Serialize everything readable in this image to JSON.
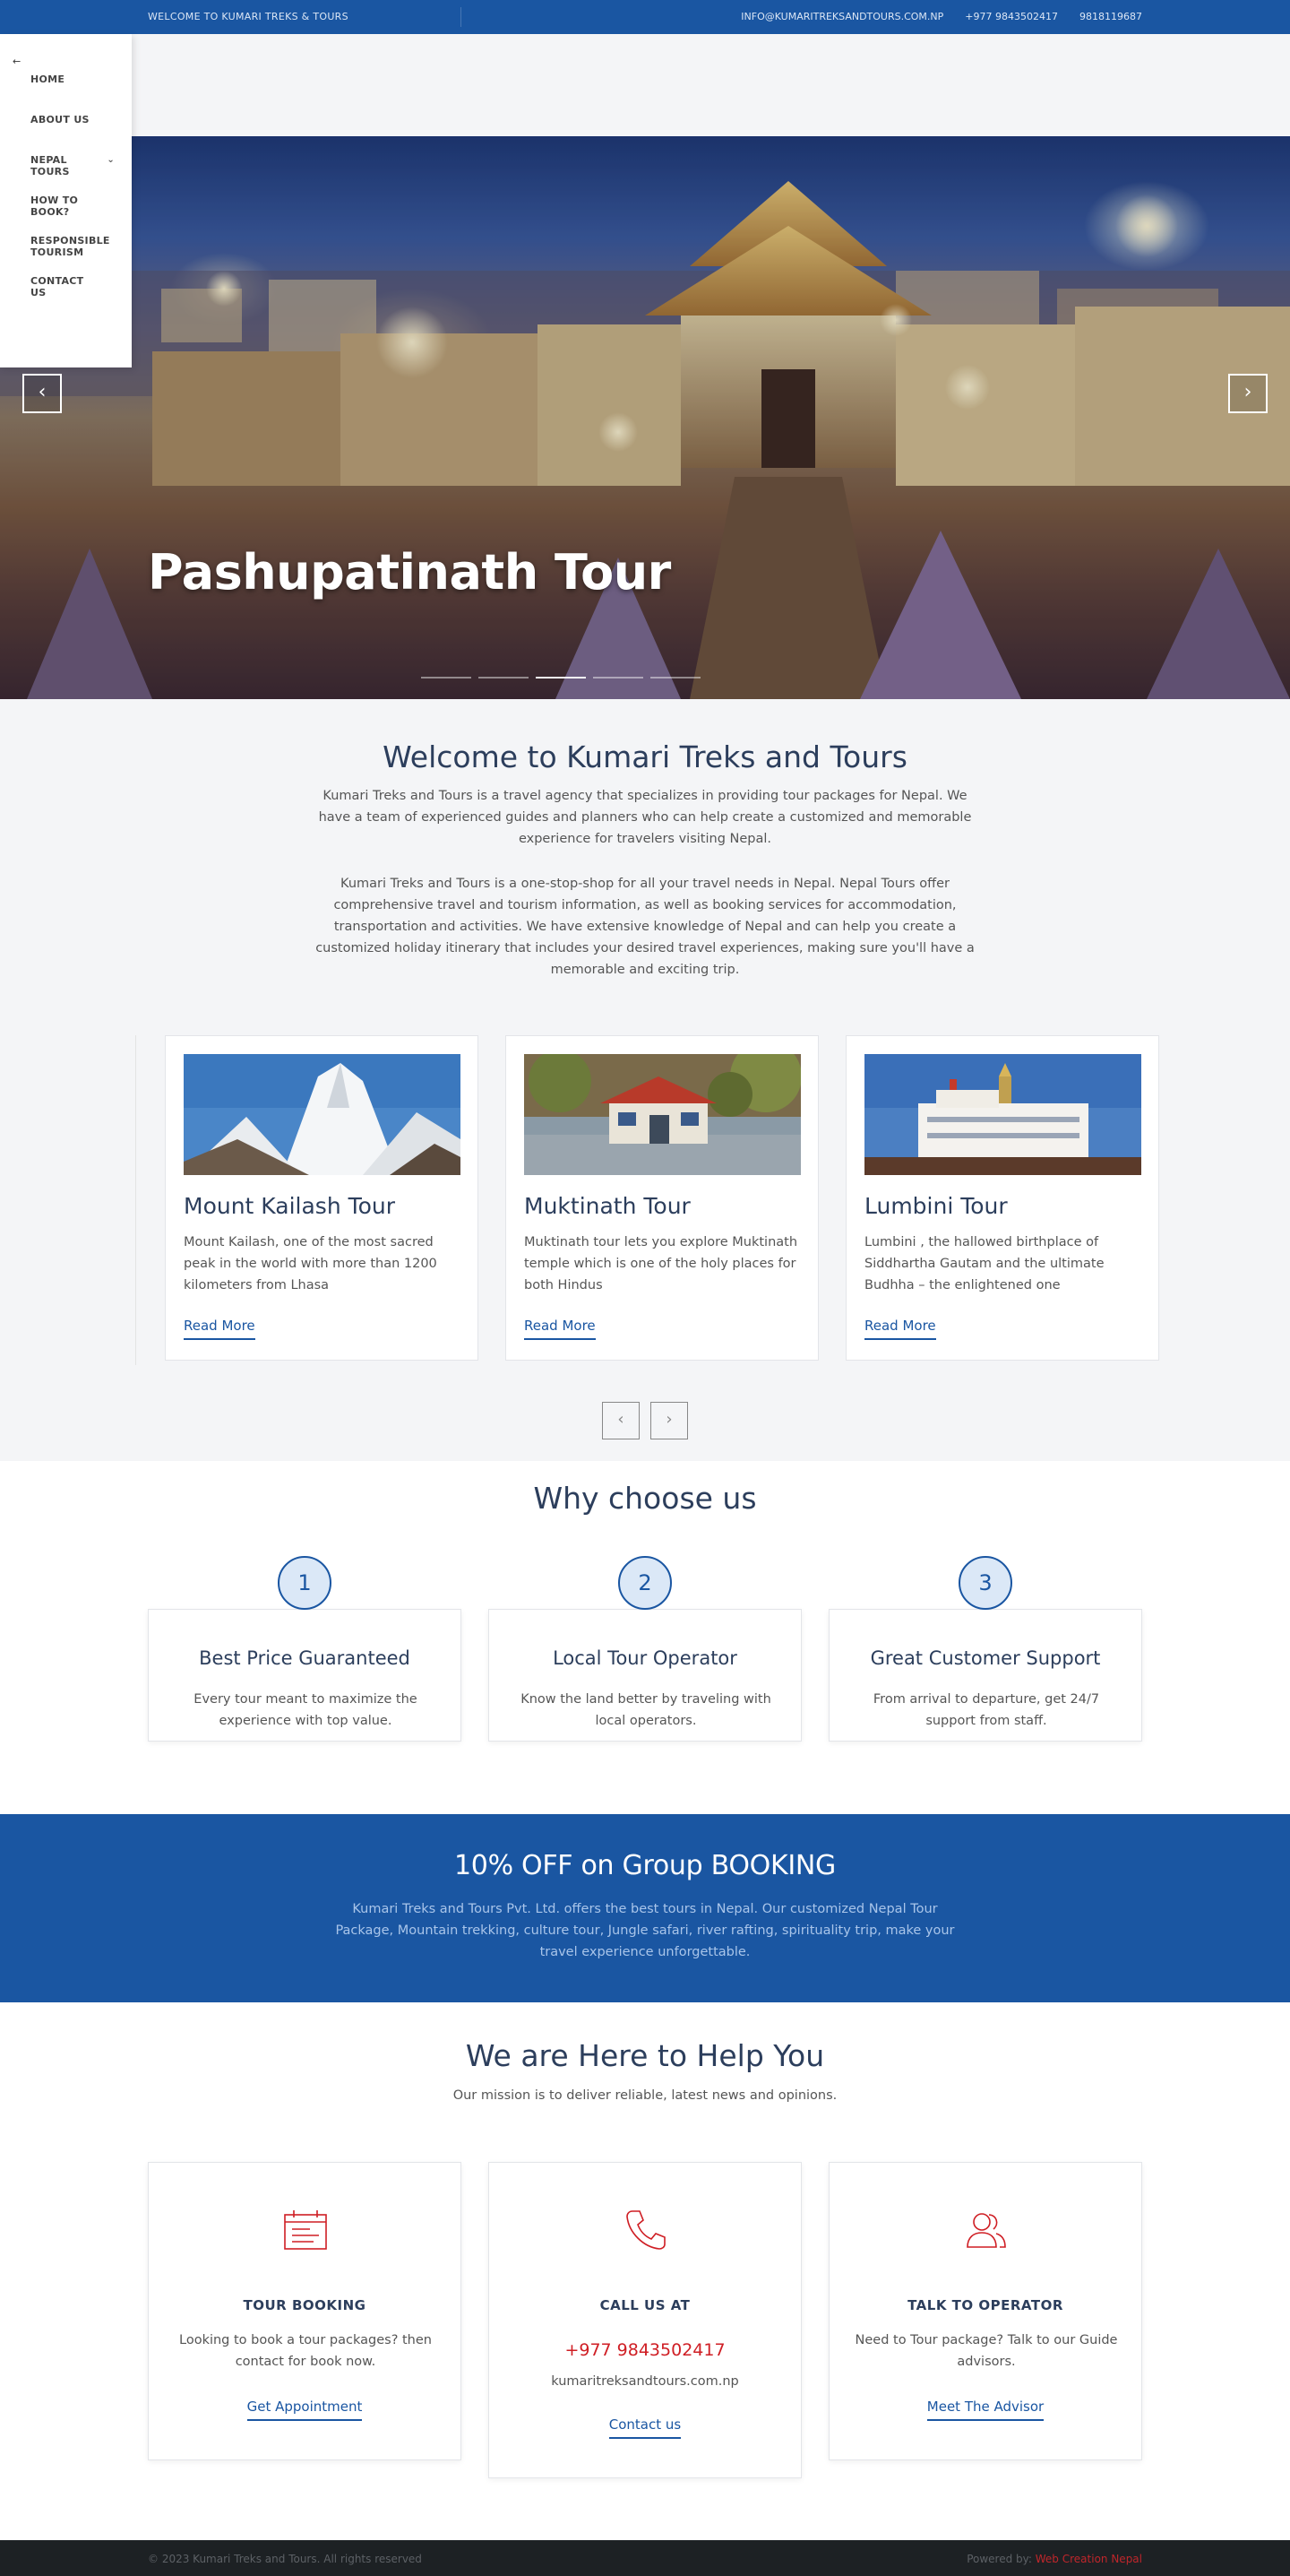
{
  "topbar": {
    "welcome": "WELCOME TO KUMARI TREKS & TOURS",
    "email": "INFO@KUMARITREKSANDTOURS.COM.NP",
    "phone1": "+977 9843502417",
    "phone2": "9818119687"
  },
  "menu": {
    "back_icon": "left-arrow-icon",
    "items": [
      {
        "label": "HOME"
      },
      {
        "label": "ABOUT US"
      },
      {
        "label": "NEPAL TOURS",
        "has_submenu": true
      },
      {
        "label": "HOW TO BOOK?"
      },
      {
        "label": "RESPONSIBLE TOURISM"
      },
      {
        "label": "CONTACT US"
      }
    ]
  },
  "hero": {
    "title": "Pashupatinath Tour",
    "prev_icon": "chevron-left-icon",
    "next_icon": "chevron-right-icon",
    "slides_count": 5,
    "active_slide": 2
  },
  "welcome": {
    "heading": "Welcome to Kumari Treks and Tours",
    "para1": "Kumari Treks and Tours is a travel agency that specializes in providing tour packages for Nepal. We have a team of experienced guides and planners who can help create a customized and memorable experience for travelers visiting Nepal.",
    "para2": "Kumari Treks and Tours is a one-stop-shop for all your travel needs in Nepal. Nepal Tours offer comprehensive travel and tourism information, as well as booking services for accommodation, transportation and activities. We have extensive knowledge of Nepal and can help you create a customized holiday itinerary that includes your desired travel experiences, making sure you'll have a memorable and exciting trip."
  },
  "tours": [
    {
      "title": "Mount Kailash Tour",
      "desc": "Mount Kailash, one of the most sacred peak in the world with more than 1200 kilometers from Lhasa",
      "link": "Read More"
    },
    {
      "title": "Muktinath Tour",
      "desc": "Muktinath tour lets you explore Muktinath temple which is one of the holy places for both Hindus",
      "link": "Read More"
    },
    {
      "title": "Lumbini Tour",
      "desc": "Lumbini , the hallowed birthplace of Siddhartha Gautam and the ultimate Budhha – the enlightened one",
      "link": "Read More"
    }
  ],
  "why": {
    "heading": "Why choose us",
    "items": [
      {
        "num": "1",
        "title": "Best Price Guaranteed",
        "desc": "Every tour meant to maximize the experience with top value."
      },
      {
        "num": "2",
        "title": "Local Tour Operator",
        "desc": "Know the land better by traveling with local operators."
      },
      {
        "num": "3",
        "title": "Great Customer Support",
        "desc": "From arrival to departure, get 24/7 support from staff."
      }
    ]
  },
  "promo": {
    "heading": "10% OFF on Group BOOKING",
    "text": "Kumari Treks and Tours Pvt. Ltd. offers the best tours in Nepal. Our customized Nepal Tour Package, Mountain trekking, culture tour, Jungle safari, river rafting, spirituality trip, make your travel experience unforgettable."
  },
  "help": {
    "heading": "We are Here to Help You",
    "sub": "Our mission is to deliver reliable, latest news and opinions.",
    "cards": [
      {
        "icon": "calendar-icon",
        "title": "TOUR BOOKING",
        "desc": "Looking to book a tour packages? then contact for book now.",
        "link": "Get Appointment"
      },
      {
        "icon": "phone-icon",
        "title": "CALL US AT",
        "phone": "+977 9843502417",
        "site": "kumaritreksandtours.com.np",
        "link": "Contact us"
      },
      {
        "icon": "users-icon",
        "title": "TALK TO OPERATOR",
        "desc": "Need to Tour package? Talk to our Guide advisors.",
        "link": "Meet The Advisor"
      }
    ]
  },
  "footer": {
    "copyright": "© 2023 Kumari Treks and Tours. All rights reserved",
    "powered_prefix": "Powered by:",
    "powered_brand": "Web Creation Nepal"
  },
  "colors": {
    "primary": "#1a56a2",
    "accent_red": "#cf1e24",
    "heading": "#2c3e5c",
    "footer_bg": "#1d2124"
  }
}
